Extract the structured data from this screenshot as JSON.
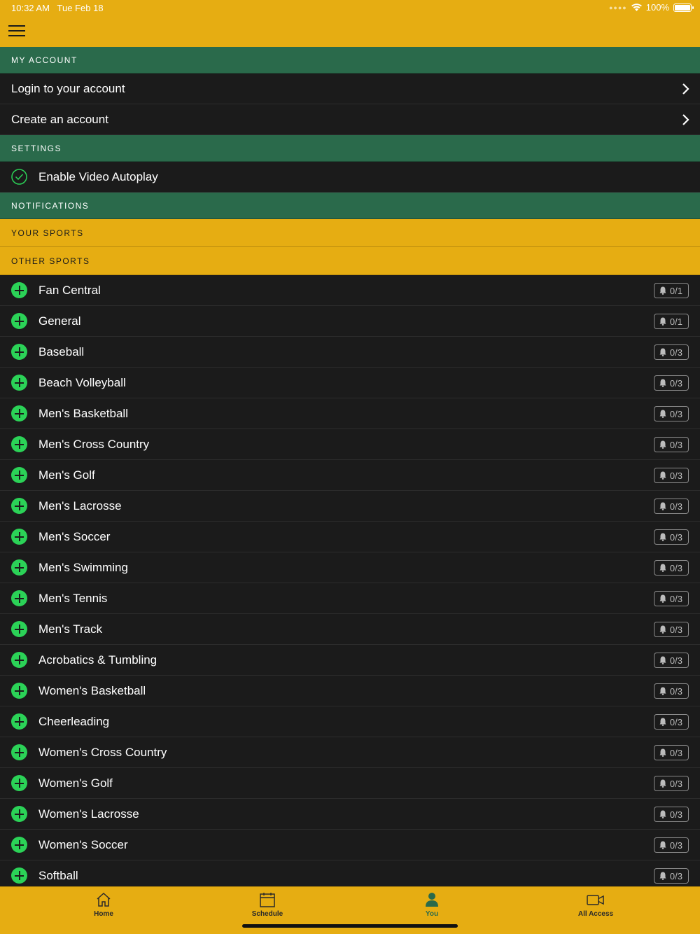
{
  "status_bar": {
    "time": "10:32 AM",
    "date": "Tue Feb 18",
    "battery": "100%"
  },
  "colors": {
    "brand_yellow": "#e6ad12",
    "section_green": "#2a6a4b",
    "add_green": "#2bd257",
    "row_bg": "#1b1b1b"
  },
  "sections": {
    "my_account": "MY ACCOUNT",
    "settings": "SETTINGS",
    "notifications": "NOTIFICATIONS",
    "your_sports": "YOUR SPORTS",
    "other_sports": "OTHER SPORTS"
  },
  "account": {
    "login": "Login to your account",
    "create": "Create an account"
  },
  "settings": {
    "autoplay": "Enable Video Autoplay",
    "autoplay_enabled": true
  },
  "sports": [
    {
      "name": "Fan Central",
      "count": "0/1"
    },
    {
      "name": "General",
      "count": "0/1"
    },
    {
      "name": "Baseball",
      "count": "0/3"
    },
    {
      "name": "Beach Volleyball",
      "count": "0/3"
    },
    {
      "name": "Men's Basketball",
      "count": "0/3"
    },
    {
      "name": "Men's Cross Country",
      "count": "0/3"
    },
    {
      "name": "Men's Golf",
      "count": "0/3"
    },
    {
      "name": "Men's Lacrosse",
      "count": "0/3"
    },
    {
      "name": "Men's Soccer",
      "count": "0/3"
    },
    {
      "name": "Men's Swimming",
      "count": "0/3"
    },
    {
      "name": "Men's Tennis",
      "count": "0/3"
    },
    {
      "name": "Men's Track",
      "count": "0/3"
    },
    {
      "name": "Acrobatics & Tumbling",
      "count": "0/3"
    },
    {
      "name": "Women's Basketball",
      "count": "0/3"
    },
    {
      "name": "Cheerleading",
      "count": "0/3"
    },
    {
      "name": "Women's Cross Country",
      "count": "0/3"
    },
    {
      "name": "Women's Golf",
      "count": "0/3"
    },
    {
      "name": "Women's Lacrosse",
      "count": "0/3"
    },
    {
      "name": "Women's Soccer",
      "count": "0/3"
    },
    {
      "name": "Softball",
      "count": "0/3"
    }
  ],
  "tabs": [
    {
      "label": "Home",
      "icon": "home-icon"
    },
    {
      "label": "Schedule",
      "icon": "calendar-icon"
    },
    {
      "label": "You",
      "icon": "person-icon",
      "active": true
    },
    {
      "label": "All Access",
      "icon": "video-icon"
    }
  ]
}
